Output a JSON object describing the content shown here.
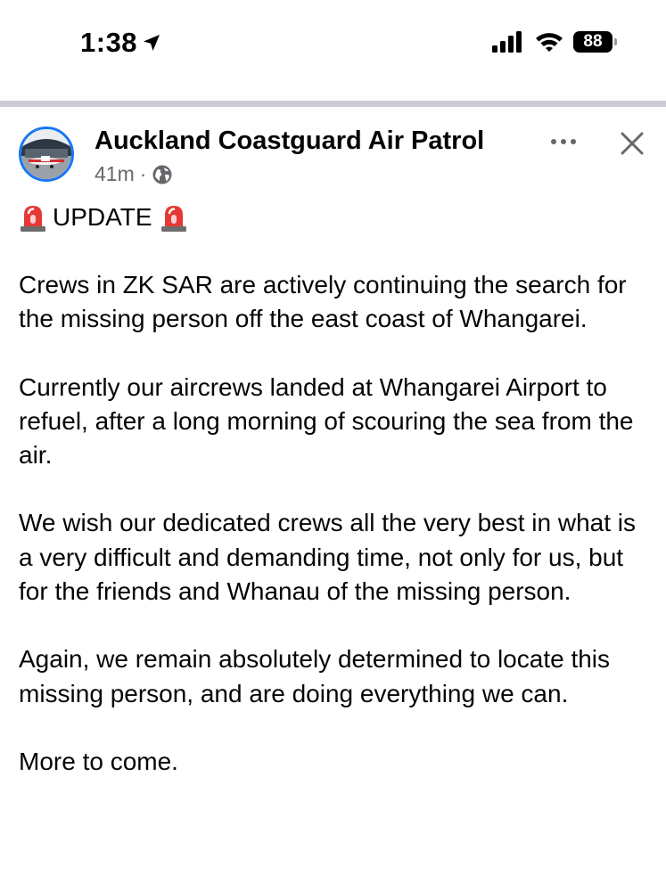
{
  "status_bar": {
    "time": "1:38",
    "battery_level": "88",
    "icons": [
      "location-arrow-icon",
      "cellular-signal-icon",
      "wifi-icon",
      "battery-icon"
    ]
  },
  "post": {
    "page_name": "Auckland Coastguard Air Patrol",
    "time_ago": "41m",
    "separator": "·",
    "audience_icon": "globe-icon",
    "header_actions": [
      "more-options-icon",
      "close-icon"
    ],
    "update_label": "UPDATE",
    "update_icon": "police-siren-emoji-icon",
    "paragraphs": [
      "Crews in ZK SAR are actively continuing the search for the missing person off the east coast of Whangarei.",
      "Currently our aircrews landed at Whangarei Airport to refuel, after a long morning of scouring the sea from the air.",
      "We wish our dedicated crews all the very best in what is a very difficult and demanding time, not only for us, but for the friends and Whanau of the missing person.",
      "Again, we remain absolutely determined to locate this missing person, and are doing everything we can.",
      "More to come."
    ]
  },
  "colors": {
    "accent_blue": "#1877f2",
    "secondary_text": "#65676b",
    "divider": "#c9ccd1",
    "siren_red": "#e53935"
  }
}
